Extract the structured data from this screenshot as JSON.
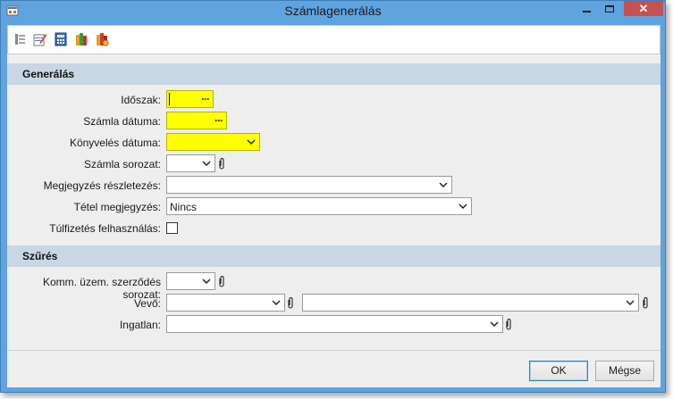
{
  "window": {
    "title": "Számlagenerálás"
  },
  "toolbar": {
    "icons": [
      "tree-icon",
      "edit-icon",
      "calculator-icon",
      "books-green-icon",
      "books-red-icon"
    ]
  },
  "generalas": {
    "header": "Generálás",
    "fields": {
      "idoszak": {
        "label": "Időszak:",
        "value": ""
      },
      "szamla_datuma": {
        "label": "Számla dátuma:",
        "value": ""
      },
      "konyveles_datuma": {
        "label": "Könyvelés dátuma:",
        "value": ""
      },
      "szamla_sorozat": {
        "label": "Számla sorozat:",
        "value": ""
      },
      "megjegyzes_reszletezes": {
        "label": "Megjegyzés részletezés:",
        "value": ""
      },
      "tetel_megjegyzes": {
        "label": "Tétel megjegyzés:",
        "value": "Nincs"
      },
      "tulfizetes": {
        "label": "Túlfizetés felhasználás:",
        "checked": false
      }
    }
  },
  "szures": {
    "header": "Szűrés",
    "fields": {
      "komm_sorozat": {
        "label": "Komm. üzem. szerződés sorozat:",
        "value": ""
      },
      "vevo": {
        "label": "Vevő:",
        "value1": "",
        "value2": ""
      },
      "ingatlan": {
        "label": "Ingatlan:",
        "value": ""
      }
    }
  },
  "footer": {
    "ok_label": "OK",
    "cancel_label": "Mégse"
  },
  "colors": {
    "required_field": "#ffff00",
    "title_bar": "#5fa4de",
    "close_button": "#c75050",
    "section_header": "#c9d6e3"
  }
}
